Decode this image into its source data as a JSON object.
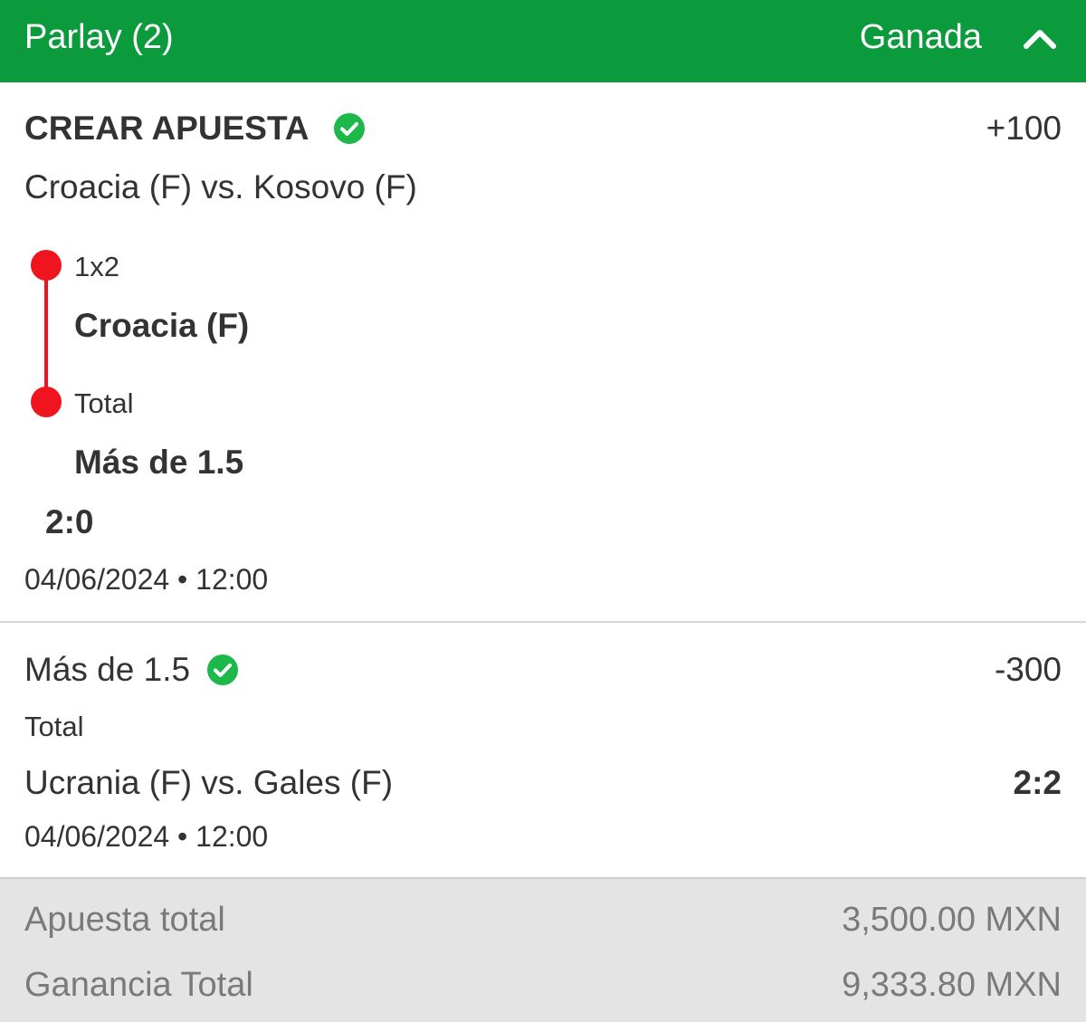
{
  "header": {
    "title": "Parlay (2)",
    "status": "Ganada",
    "chevron_icon": "chevron-up-icon",
    "color": "#0b9a3c"
  },
  "leg1": {
    "title": "CREAR APUESTA",
    "status_icon": "check-circle-icon",
    "odds": "+100",
    "match": "Croacia (F) vs. Kosovo (F)",
    "selections": [
      {
        "market": "1x2",
        "pick": "Croacia (F)"
      },
      {
        "market": "Total",
        "pick": "Más de 1.5"
      }
    ],
    "score": "2:0",
    "datetime": "04/06/2024 • 12:00",
    "timeline_color": "#f0141e"
  },
  "leg2": {
    "pick": "Más de 1.5",
    "status_icon": "check-circle-icon",
    "odds": "-300",
    "market": "Total",
    "match": "Ucrania (F) vs. Gales (F)",
    "score": "2:2",
    "datetime": "04/06/2024 • 12:00"
  },
  "summary": {
    "stake_label": "Apuesta total",
    "stake_value": "3,500.00 MXN",
    "payout_label": "Ganancia Total",
    "payout_value": "9,333.80 MXN"
  }
}
